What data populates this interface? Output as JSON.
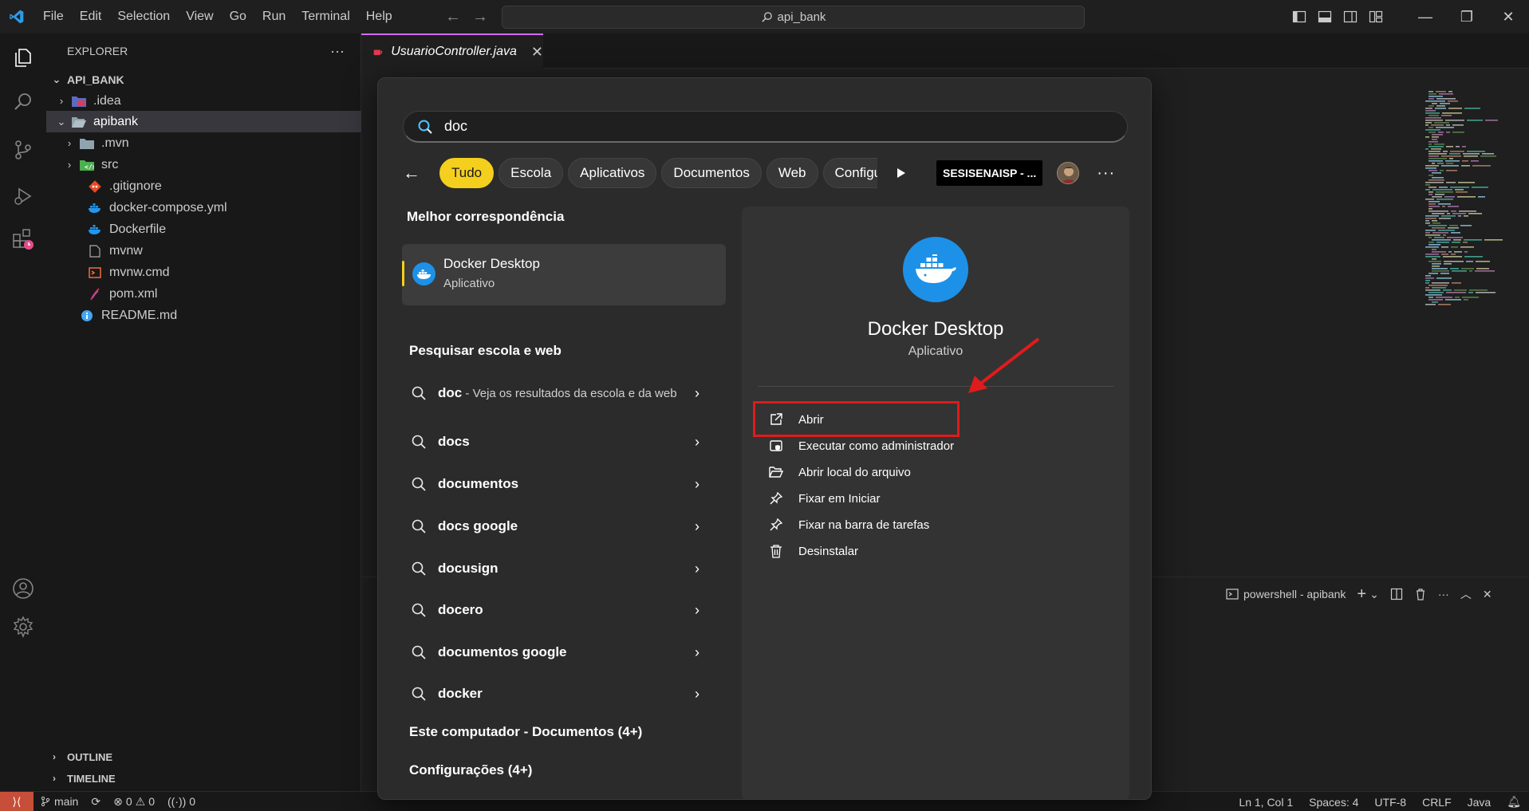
{
  "titlebar": {
    "menu": [
      "File",
      "Edit",
      "Selection",
      "View",
      "Go",
      "Run",
      "Terminal",
      "Help"
    ],
    "search_text": "api_bank"
  },
  "sidebar": {
    "title": "EXPLORER",
    "project": "API_BANK",
    "items": [
      {
        "label": ".idea",
        "icon": "folder-idea-icon"
      },
      {
        "label": "apibank",
        "icon": "folder-open-icon"
      },
      {
        "label": ".mvn",
        "icon": "folder-icon"
      },
      {
        "label": "src",
        "icon": "folder-src-icon"
      },
      {
        "label": ".gitignore",
        "icon": "git-icon"
      },
      {
        "label": "docker-compose.yml",
        "icon": "docker-icon"
      },
      {
        "label": "Dockerfile",
        "icon": "docker-icon"
      },
      {
        "label": "mvnw",
        "icon": "file-icon"
      },
      {
        "label": "mvnw.cmd",
        "icon": "terminal-file-icon"
      },
      {
        "label": "pom.xml",
        "icon": "maven-icon"
      },
      {
        "label": "README.md",
        "icon": "info-icon"
      }
    ],
    "sections": [
      "OUTLINE",
      "TIMELINE"
    ]
  },
  "editor": {
    "tab_label": "UsuarioController.java"
  },
  "panel": {
    "terminal_label": "powershell - apibank"
  },
  "statusbar": {
    "branch": "main",
    "errors": "0",
    "warnings": "0",
    "ports": "0",
    "position": "Ln 1, Col 1",
    "spaces": "Spaces: 4",
    "encoding": "UTF-8",
    "eol": "CRLF",
    "language": "Java"
  },
  "search": {
    "query": "doc",
    "filters": [
      "Tudo",
      "Escola",
      "Aplicativos",
      "Documentos",
      "Web",
      "Configurações"
    ],
    "active_filter": "Tudo",
    "org_badge": "SESISENAISP - ...",
    "best_match_title": "Melhor correspondência",
    "best_match": {
      "name": "Docker Desktop",
      "type": "Aplicativo"
    },
    "web_section_title": "Pesquisar escola e web",
    "suggestions": [
      {
        "term": "doc",
        "sub": " - Veja os resultados da escola e da web"
      },
      {
        "term": "docs",
        "sub": ""
      },
      {
        "term": "documentos",
        "sub": ""
      },
      {
        "term": "docs google",
        "sub": ""
      },
      {
        "term": "docusign",
        "sub": ""
      },
      {
        "term": "docero",
        "sub": ""
      },
      {
        "term": "documentos google",
        "sub": ""
      },
      {
        "term": "docker",
        "sub": ""
      }
    ],
    "computer_section": "Este computador - Documentos (4+)",
    "settings_section": "Configurações (4+)",
    "details": {
      "name": "Docker Desktop",
      "type": "Aplicativo",
      "actions": [
        {
          "label": "Abrir",
          "icon": "open-external-icon"
        },
        {
          "label": "Executar como administrador",
          "icon": "shield-admin-icon"
        },
        {
          "label": "Abrir local do arquivo",
          "icon": "folder-open-icon"
        },
        {
          "label": "Fixar em Iniciar",
          "icon": "pin-icon"
        },
        {
          "label": "Fixar na barra de tarefas",
          "icon": "pin-taskbar-icon"
        },
        {
          "label": "Desinstalar",
          "icon": "trash-icon"
        }
      ]
    }
  },
  "colors": {
    "accent_yellow": "#f5cf1d",
    "docker_blue": "#1d91e8",
    "annotation_red": "#e01b1b",
    "tab_accent": "#d16cff"
  }
}
